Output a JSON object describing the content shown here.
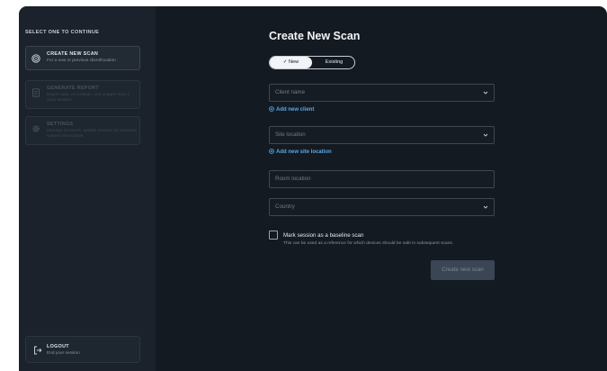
{
  "sidebar": {
    "heading": "SELECT ONE TO CONTINUE",
    "items": [
      {
        "title": "CREATE NEW SCAN",
        "subtitle": "For a new or previous client/location",
        "icon": "target-icon"
      },
      {
        "title": "GENERATE REPORT",
        "subtitle": "Export data, recordings, and images from a scan session",
        "icon": "document-icon"
      },
      {
        "title": "SETTINGS",
        "subtitle": "Manage accounts, update sensors on sensitive system information",
        "icon": "gear-icon"
      }
    ],
    "logout": {
      "title": "LOGOUT",
      "subtitle": "End your session",
      "icon": "logout-icon"
    }
  },
  "main": {
    "title": "Create New Scan",
    "toggle": {
      "selected": "New",
      "other": "Existing"
    },
    "fields": {
      "client_placeholder": "Client name",
      "site_placeholder": "Site location",
      "room_placeholder": "Room location",
      "country_placeholder": "Country"
    },
    "links": {
      "add_client": "Add new client",
      "add_site": "Add new site location"
    },
    "baseline": {
      "label": "Mark session as a baseline scan",
      "help": "This can be used as a reference for which devices should be safe in subsequent scans."
    },
    "submit": "Create new scan"
  },
  "colors": {
    "background": "#141a21",
    "sidebar": "#1b222b",
    "accent_link": "#5aa7e6",
    "button_disabled": "#3a4654"
  }
}
